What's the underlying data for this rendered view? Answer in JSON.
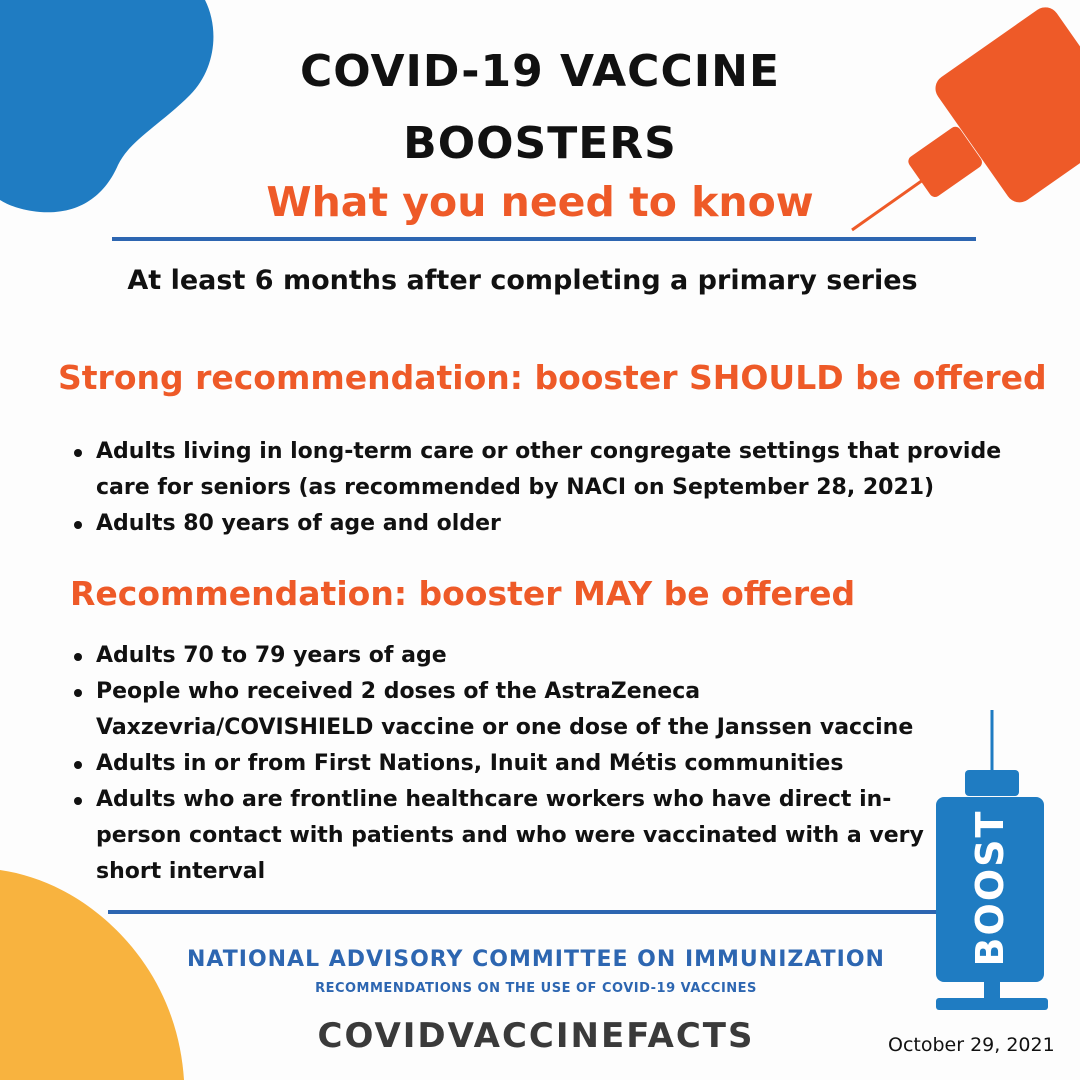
{
  "colors": {
    "accent_orange": "#ee5a28",
    "accent_blue": "#2d66b1",
    "blob_blue": "#1f7cc2",
    "blob_yellow": "#f8b33f",
    "text_dark": "#111111"
  },
  "header": {
    "title_line1": "COVID-19 VACCINE",
    "title_line2": "BOOSTERS",
    "subtitle": "What you need to know"
  },
  "lead": "At least 6 months after completing a primary series",
  "sections": [
    {
      "heading": "Strong recommendation: booster SHOULD be offered",
      "items": [
        "Adults living in long-term care or other congregate settings that provide care for seniors (as recommended by NACI on September 28, 2021)",
        "Adults 80 years of age and older"
      ]
    },
    {
      "heading": "Recommendation: booster MAY be offered",
      "items": [
        "Adults 70 to 79 years of age",
        "People who received 2 doses of the AstraZeneca Vaxzevria/COVISHIELD vaccine or one dose of the Janssen vaccine",
        "Adults in or from First Nations, Inuit and Métis communities",
        "Adults who are frontline healthcare workers who have direct in-person contact with patients and who were vaccinated with a very short interval"
      ]
    }
  ],
  "syringe_label": "BOOST",
  "footer": {
    "org": "NATIONAL ADVISORY COMMITTEE ON IMMUNIZATION",
    "org_sub": "RECOMMENDATIONS ON THE USE OF COVID-19 VACCINES",
    "brand": "COVIDVACCINEFACTS",
    "date": "October 29, 2021"
  },
  "icons": [
    "blue-blob",
    "orange-syringe-icon",
    "yellow-blob",
    "blue-syringe-icon"
  ]
}
